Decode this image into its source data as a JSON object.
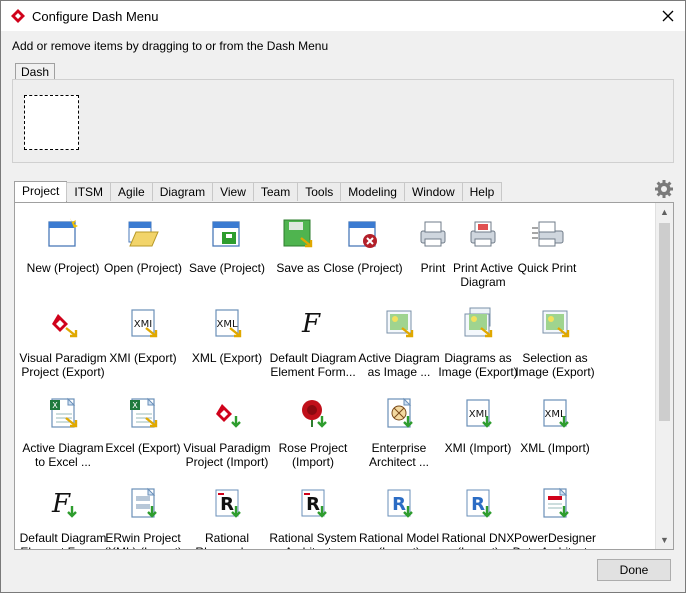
{
  "window": {
    "title": "Configure Dash Menu",
    "instruction": "Add or remove items by dragging to or from the Dash Menu"
  },
  "dash": {
    "tab_label": "Dash"
  },
  "tabs": [
    {
      "label": "Project",
      "active": true
    },
    {
      "label": "ITSM"
    },
    {
      "label": "Agile"
    },
    {
      "label": "Diagram"
    },
    {
      "label": "View"
    },
    {
      "label": "Team"
    },
    {
      "label": "Tools"
    },
    {
      "label": "Modeling"
    },
    {
      "label": "Window"
    },
    {
      "label": "Help"
    }
  ],
  "items": [
    {
      "label": "New (Project)",
      "icon": "new-project-icon"
    },
    {
      "label": "Open (Project)",
      "icon": "open-project-icon"
    },
    {
      "label": "Save (Project)",
      "icon": "save-project-icon"
    },
    {
      "label": "Save as",
      "icon": "save-as-icon"
    },
    {
      "label": "Close (Project)",
      "icon": "close-project-icon"
    },
    {
      "label": "Print",
      "icon": "print-icon"
    },
    {
      "label": "Print Active\nDiagram",
      "icon": "print-active-diagram-icon"
    },
    {
      "label": "Quick Print",
      "icon": "quick-print-icon"
    },
    {
      "label": "Visual Paradigm\nProject (Export)",
      "icon": "vp-export-icon"
    },
    {
      "label": "XMI (Export)",
      "icon": "xmi-export-icon"
    },
    {
      "label": "XML (Export)",
      "icon": "xml-export-icon"
    },
    {
      "label": "Default Diagram\nElement Form...",
      "icon": "diagram-element-format-icon"
    },
    {
      "label": "Active Diagram\nas Image ...",
      "icon": "diagram-image-icon"
    },
    {
      "label": "Diagrams as\nImage (Export)",
      "icon": "diagrams-image-icon"
    },
    {
      "label": "Selection as\nImage (Export)",
      "icon": "selection-image-icon"
    },
    {
      "label": "Active Diagram\nto Excel ...",
      "icon": "diagram-excel-icon"
    },
    {
      "label": "Excel (Export)",
      "icon": "excel-export-icon"
    },
    {
      "label": "Visual Paradigm\nProject (Import)",
      "icon": "vp-import-icon"
    },
    {
      "label": "Rose Project\n(Import)",
      "icon": "rose-import-icon"
    },
    {
      "label": "Enterprise\nArchitect ...",
      "icon": "enterprise-architect-icon"
    },
    {
      "label": "XMI (Import)",
      "icon": "xmi-import-icon"
    },
    {
      "label": "XML (Import)",
      "icon": "xml-import-icon"
    },
    {
      "label": "Default Diagram\nElement Form...",
      "icon": "diagram-element-format-import-icon"
    },
    {
      "label": "ERwin Project\n(XML) (Import)",
      "icon": "erwin-import-icon"
    },
    {
      "label": "Rational\nRhapsody...",
      "icon": "rational-rhapsody-icon"
    },
    {
      "label": "Rational System\nArchitect...",
      "icon": "rational-system-architect-icon"
    },
    {
      "label": "Rational Model\n(Import)",
      "icon": "rational-model-import-icon"
    },
    {
      "label": "Rational DNX\n(Import)",
      "icon": "rational-dnx-import-icon"
    },
    {
      "label": "PowerDesigner\nData Architect...",
      "icon": "powerdesigner-icon"
    }
  ],
  "buttons": {
    "done": "Done"
  },
  "colors": {
    "accent": "#d0021b",
    "green": "#3a9d3a",
    "blue": "#2b6cc4"
  }
}
